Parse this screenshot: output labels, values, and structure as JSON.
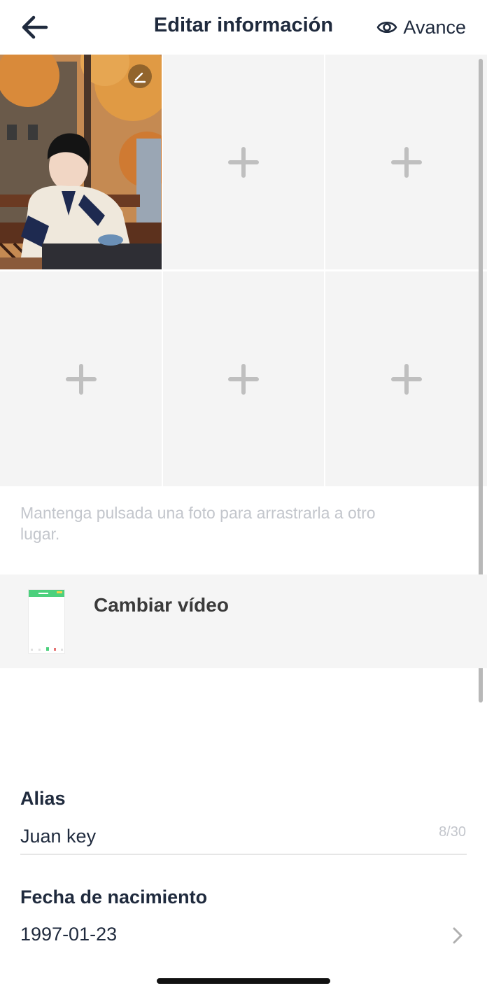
{
  "header": {
    "title": "Editar información",
    "back_icon": "arrow-left-icon",
    "preview_label": "Avance",
    "preview_icon": "eye-icon"
  },
  "photos": {
    "slots": [
      {
        "filled": true,
        "edit_icon": "pencil-icon"
      },
      {
        "filled": false,
        "icon": "plus-icon"
      },
      {
        "filled": false,
        "icon": "plus-icon"
      },
      {
        "filled": false,
        "icon": "plus-icon"
      },
      {
        "filled": false,
        "icon": "plus-icon"
      },
      {
        "filled": false,
        "icon": "plus-icon"
      }
    ],
    "hint": "Mantenga pulsada una foto para arrastrarla a otro lugar."
  },
  "video": {
    "label": "Cambiar vídeo"
  },
  "alias": {
    "label": "Alias",
    "value": "Juan key",
    "counter": "8/30"
  },
  "birthdate": {
    "label": "Fecha de nacimiento",
    "value": "1997-01-23",
    "icon": "chevron-right-icon"
  },
  "colors": {
    "text": "#1f2a3d",
    "hint": "#c3c6cc",
    "slot_background": "#f4f4f4",
    "plus": "#bfbfbf",
    "video_accent": "#4cd07d"
  }
}
